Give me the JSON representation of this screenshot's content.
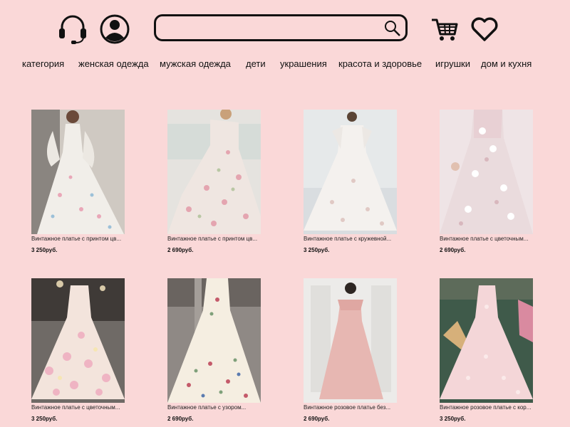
{
  "header": {
    "search": {
      "value": "",
      "placeholder": ""
    },
    "icons": {
      "support": "headset-icon",
      "profile": "user-icon",
      "search": "magnifier-icon",
      "cart": "cart-icon",
      "favorites": "heart-icon"
    }
  },
  "nav": {
    "items": [
      "категория",
      "женская одежда",
      "мужская одежда",
      "дети",
      "украшения",
      "красота и здоровье",
      "игрушки",
      "дом и кухня"
    ]
  },
  "products": [
    {
      "title": "Винтажное платье с принтом цв...",
      "price": "3 250руб."
    },
    {
      "title": "Винтажное платье с принтом цв...",
      "price": "2 690руб."
    },
    {
      "title": "Винтажное платье с кружевной...",
      "price": "3 250руб."
    },
    {
      "title": "Винтажное платье с цветочным...",
      "price": "2 690руб."
    },
    {
      "title": "Винтажное платье с цветочным...",
      "price": "3 250руб."
    },
    {
      "title": "Винтажное платье с узором...",
      "price": "2 690руб."
    },
    {
      "title": "Винтажное розовое платье без...",
      "price": "2 690руб."
    },
    {
      "title": "Винтажное розовое платье с кор...",
      "price": "3 250руб."
    }
  ],
  "colors": {
    "background": "#fad8d8",
    "text": "#111111"
  }
}
